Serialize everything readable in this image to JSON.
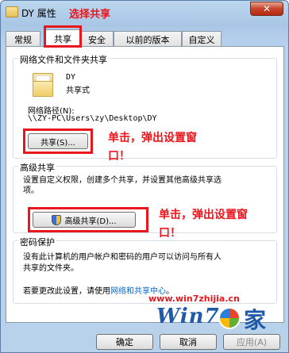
{
  "window": {
    "title": "DY 属性",
    "annotation": "选择共享",
    "close_glyph": "✕"
  },
  "tabs": [
    {
      "label": "常规"
    },
    {
      "label": "共享"
    },
    {
      "label": "安全"
    },
    {
      "label": "以前的版本"
    },
    {
      "label": "自定义"
    }
  ],
  "network_sharing": {
    "title": "网络文件和文件夹共享",
    "folder_name": "DY",
    "folder_status": "共享式",
    "path_label": "网络路径(N):",
    "path_value": "\\\\ZY-PC\\Users\\zy\\Desktop\\DY",
    "share_button": "共享(S)...",
    "annotation_line1": "单击，弹出设置窗",
    "annotation_line2": "口！"
  },
  "advanced_sharing": {
    "title": "高级共享",
    "description_line1": "设置自定义权限，创建多个共享，并设置其他高级共享选",
    "description_line2": "项。",
    "button": "高级共享(D)...",
    "annotation_line1": "单击，弹出设置窗",
    "annotation_line2": "口！"
  },
  "password_protection": {
    "title": "密码保护",
    "line1": "没有此计算机的用户帐户和密码的用户可以访问与所有人",
    "line2": "共享的文件夹。",
    "change_text": "若要更改此设置，请使用",
    "link": "网络和共享中心",
    "period": "。"
  },
  "footer": {
    "ok": "确定",
    "cancel": "取消",
    "apply": "应用(A)"
  },
  "watermark": {
    "url": "www.win7zhijia.cn",
    "logo_text": "Win7",
    "logo_char": "家"
  },
  "colors": {
    "annotation_red": "#e8161d",
    "link_blue": "#0066cc"
  }
}
